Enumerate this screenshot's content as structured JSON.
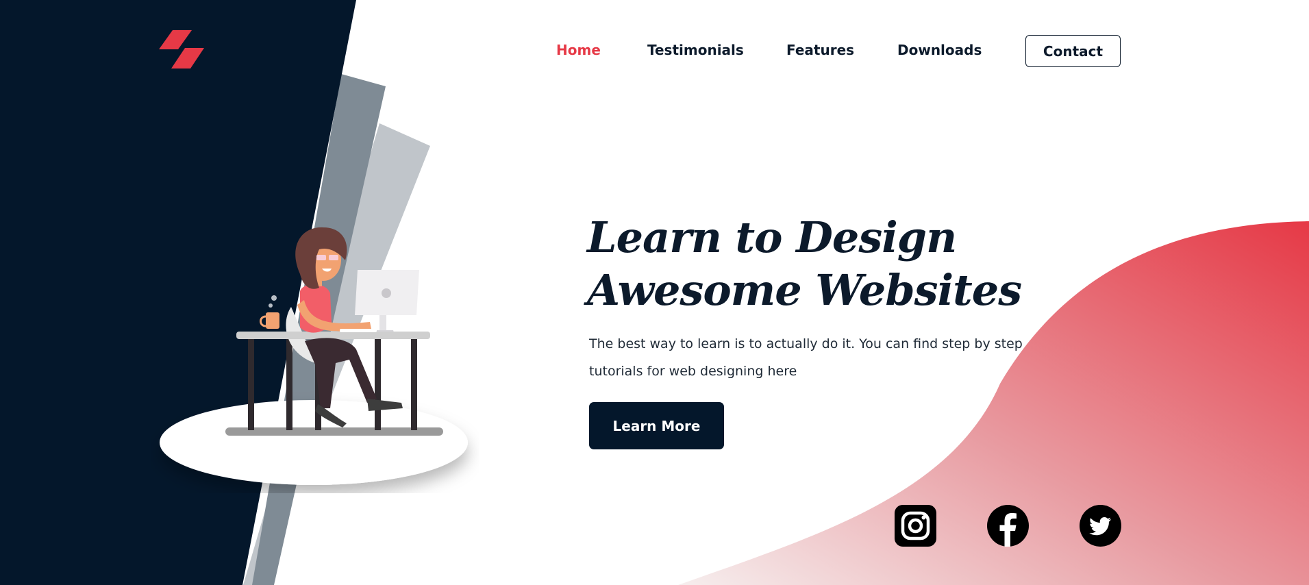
{
  "colors": {
    "dark": "#04172b",
    "accent": "#e63946",
    "text": "#0c1a2b"
  },
  "logo": {
    "icon": "logo-icon"
  },
  "nav": {
    "items": [
      {
        "label": "Home",
        "active": true
      },
      {
        "label": "Testimonials",
        "active": false
      },
      {
        "label": "Features",
        "active": false
      },
      {
        "label": "Downloads",
        "active": false
      }
    ],
    "contact_label": "Contact"
  },
  "hero": {
    "title_line1": "Learn to Design",
    "title_line2": "Awesome Websites",
    "description": "The best way to learn is to actually do it. You can find step by step tutorials for web designing here",
    "cta_label": "Learn More"
  },
  "illustration": {
    "icon": "woman-at-desk-illustration"
  },
  "social": [
    {
      "icon": "instagram-icon"
    },
    {
      "icon": "facebook-icon"
    },
    {
      "icon": "twitter-icon"
    }
  ]
}
